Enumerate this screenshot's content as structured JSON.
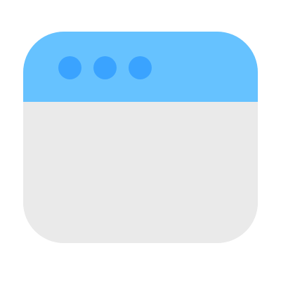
{
  "icon": {
    "name": "browser-window-icon",
    "colors": {
      "title_bar": "#66c2ff",
      "dots": "#3aa3ff",
      "body": "#eaeaea",
      "background": "#ffffff"
    },
    "dots": [
      {
        "name": "window-dot-1"
      },
      {
        "name": "window-dot-2"
      },
      {
        "name": "window-dot-3"
      }
    ]
  }
}
